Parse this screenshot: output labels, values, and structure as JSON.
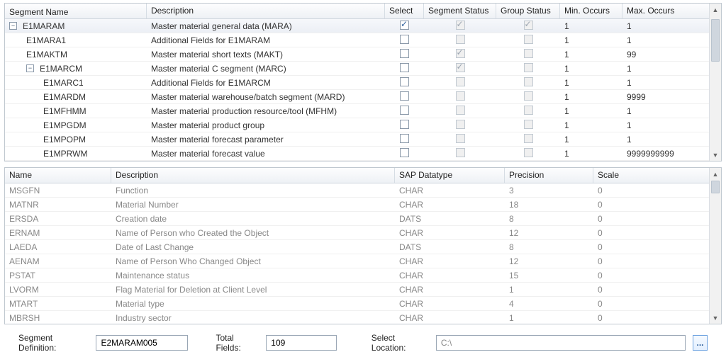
{
  "top_grid": {
    "headers": {
      "segname": "Segment Name",
      "desc": "Description",
      "select": "Select",
      "segstat": "Segment Status",
      "grpstat": "Group Status",
      "min": "Min. Occurs",
      "max": "Max. Occurs"
    },
    "rows": [
      {
        "name": "E1MARAM",
        "desc": "Master material general data (MARA)",
        "indent": 0,
        "tree": "minus",
        "select": "checked",
        "segstat": "checked-disabled",
        "grpstat": "checked-disabled",
        "min": "1",
        "max": "1",
        "selected": true
      },
      {
        "name": "E1MARA1",
        "desc": "Additional Fields for E1MARAM",
        "indent": 1,
        "tree": "",
        "select": "unchecked",
        "segstat": "disabled",
        "grpstat": "disabled",
        "min": "1",
        "max": "1"
      },
      {
        "name": "E1MAKTM",
        "desc": "Master material short texts (MAKT)",
        "indent": 1,
        "tree": "",
        "select": "unchecked",
        "segstat": "checked-disabled",
        "grpstat": "disabled",
        "min": "1",
        "max": "99"
      },
      {
        "name": "E1MARCM",
        "desc": "Master material C segment (MARC)",
        "indent": 1,
        "tree": "minus",
        "select": "unchecked",
        "segstat": "checked-disabled",
        "grpstat": "disabled",
        "min": "1",
        "max": "1"
      },
      {
        "name": "E1MARC1",
        "desc": "Additional Fields for E1MARCM",
        "indent": 2,
        "tree": "",
        "select": "unchecked",
        "segstat": "disabled",
        "grpstat": "disabled",
        "min": "1",
        "max": "1"
      },
      {
        "name": "E1MARDM",
        "desc": "Master material warehouse/batch segment (MARD)",
        "indent": 2,
        "tree": "",
        "select": "unchecked",
        "segstat": "disabled",
        "grpstat": "disabled",
        "min": "1",
        "max": "9999"
      },
      {
        "name": "E1MFHMM",
        "desc": "Master material production resource/tool (MFHM)",
        "indent": 2,
        "tree": "",
        "select": "unchecked",
        "segstat": "disabled",
        "grpstat": "disabled",
        "min": "1",
        "max": "1"
      },
      {
        "name": "E1MPGDM",
        "desc": "Master material product group",
        "indent": 2,
        "tree": "",
        "select": "unchecked",
        "segstat": "disabled",
        "grpstat": "disabled",
        "min": "1",
        "max": "1"
      },
      {
        "name": "E1MPOPM",
        "desc": "Master material forecast parameter",
        "indent": 2,
        "tree": "",
        "select": "unchecked",
        "segstat": "disabled",
        "grpstat": "disabled",
        "min": "1",
        "max": "1"
      },
      {
        "name": "E1MPRWM",
        "desc": "Master material forecast value",
        "indent": 2,
        "tree": "",
        "select": "unchecked",
        "segstat": "disabled",
        "grpstat": "disabled",
        "min": "1",
        "max": "9999999999"
      }
    ]
  },
  "bottom_grid": {
    "headers": {
      "name": "Name",
      "desc": "Description",
      "sdt": "SAP Datatype",
      "prec": "Precision",
      "scale": "Scale"
    },
    "rows": [
      {
        "name": "MSGFN",
        "desc": "Function",
        "sdt": "CHAR",
        "prec": "3",
        "scale": "0"
      },
      {
        "name": "MATNR",
        "desc": "Material Number",
        "sdt": "CHAR",
        "prec": "18",
        "scale": "0"
      },
      {
        "name": "ERSDA",
        "desc": "Creation date",
        "sdt": "DATS",
        "prec": "8",
        "scale": "0"
      },
      {
        "name": "ERNAM",
        "desc": "Name of Person who Created the Object",
        "sdt": "CHAR",
        "prec": "12",
        "scale": "0"
      },
      {
        "name": "LAEDA",
        "desc": "Date of Last Change",
        "sdt": "DATS",
        "prec": "8",
        "scale": "0"
      },
      {
        "name": "AENAM",
        "desc": "Name of Person Who Changed Object",
        "sdt": "CHAR",
        "prec": "12",
        "scale": "0"
      },
      {
        "name": "PSTAT",
        "desc": "Maintenance status",
        "sdt": "CHAR",
        "prec": "15",
        "scale": "0"
      },
      {
        "name": "LVORM",
        "desc": "Flag Material for Deletion at Client Level",
        "sdt": "CHAR",
        "prec": "1",
        "scale": "0"
      },
      {
        "name": "MTART",
        "desc": "Material type",
        "sdt": "CHAR",
        "prec": "4",
        "scale": "0"
      },
      {
        "name": "MBRSH",
        "desc": "Industry sector",
        "sdt": "CHAR",
        "prec": "1",
        "scale": "0"
      }
    ]
  },
  "footer": {
    "segdef_label": "Segment Definition:",
    "segdef_value": "E2MARAM005",
    "total_label": "Total Fields:",
    "total_value": "109",
    "selloc_label": "Select Location:",
    "selloc_value": "C:\\",
    "browse": "..."
  }
}
